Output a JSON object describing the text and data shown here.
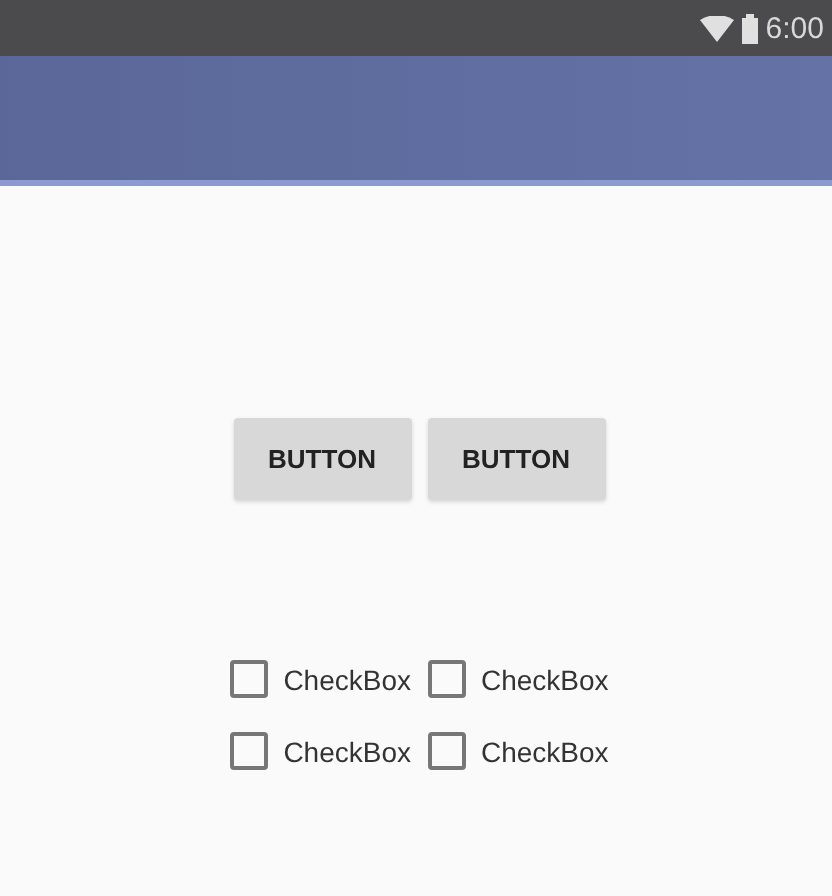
{
  "status_bar": {
    "time": "6:00"
  },
  "buttons": [
    "BUTTON",
    "BUTTON"
  ],
  "checkboxes": [
    {
      "label": "CheckBox",
      "checked": false
    },
    {
      "label": "CheckBox",
      "checked": false
    },
    {
      "label": "CheckBox",
      "checked": false
    },
    {
      "label": "CheckBox",
      "checked": false
    }
  ]
}
